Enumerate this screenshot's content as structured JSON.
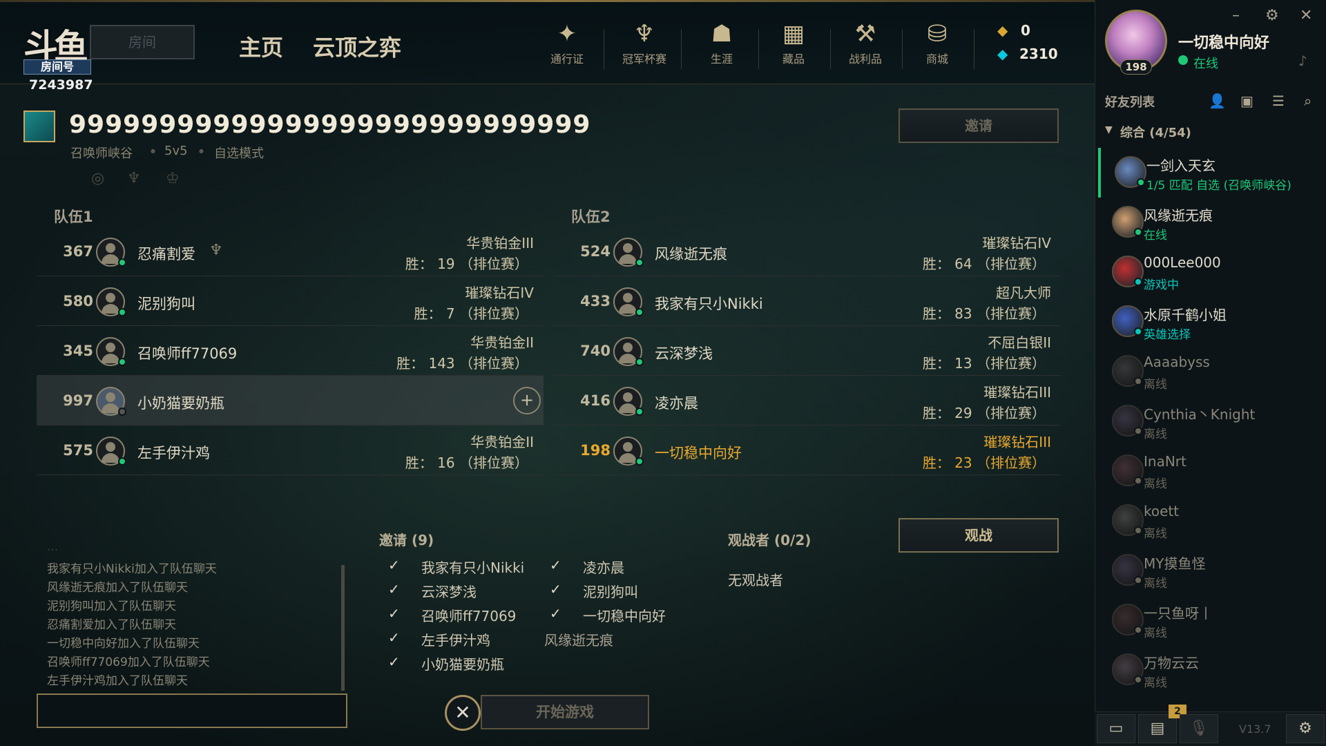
{
  "room": {
    "logo_text": "斗鱼",
    "tag": "房间号",
    "number": "7243987",
    "input_placeholder": "房间"
  },
  "nav": {
    "home": "主页",
    "tft": "云顶之弈"
  },
  "top_icons": [
    {
      "label": "通行证",
      "icon": "pass-icon"
    },
    {
      "label": "冠军杯赛",
      "icon": "trophy-icon"
    },
    {
      "label": "生涯",
      "icon": "profile-icon"
    },
    {
      "label": "藏品",
      "icon": "collection-icon"
    },
    {
      "label": "战利品",
      "icon": "loot-icon"
    },
    {
      "label": "商城",
      "icon": "store-icon"
    }
  ],
  "currency": {
    "rp": "0",
    "be": "2310"
  },
  "me": {
    "name": "一切稳中向好",
    "status": "在线",
    "level": "198"
  },
  "lobby": {
    "title": "99999999999999999999999999999",
    "map": "召唤师峡谷",
    "mode": "5v5",
    "queue": "自选模式",
    "invite_button": "邀请",
    "spectate_button": "观战"
  },
  "team1": {
    "label": "队伍1",
    "players": [
      {
        "num": "367",
        "name": "忍痛割爱",
        "rank": "华贵铂金III",
        "wins": "胜： 19 （排位赛）"
      },
      {
        "num": "580",
        "name": "泥别狗叫",
        "rank": "璀璨钻石IV",
        "wins": "胜： 7 （排位赛）"
      },
      {
        "num": "345",
        "name": "召唤师ff77069",
        "rank": "华贵铂金II",
        "wins": "胜： 143 （排位赛）"
      },
      {
        "num": "997",
        "name": "小奶猫要奶瓶",
        "rank": "",
        "wins": ""
      },
      {
        "num": "575",
        "name": "左手伊汁鸡",
        "rank": "华贵铂金II",
        "wins": "胜： 16 （排位赛）"
      }
    ]
  },
  "team2": {
    "label": "队伍2",
    "players": [
      {
        "num": "524",
        "name": "风缘逝无痕",
        "rank": "璀璨钻石IV",
        "wins": "胜： 64 （排位赛）"
      },
      {
        "num": "433",
        "name": "我家有只小Nikki",
        "rank": "超凡大师",
        "wins": "胜： 83 （排位赛）"
      },
      {
        "num": "740",
        "name": "云深梦浅",
        "rank": "不屈白银II",
        "wins": "胜： 13 （排位赛）"
      },
      {
        "num": "416",
        "name": "凌亦晨",
        "rank": "璀璨钻石III",
        "wins": "胜： 29 （排位赛）"
      },
      {
        "num": "198",
        "name": "一切稳中向好",
        "rank": "璀璨钻石III",
        "wins": "胜： 23 （排位赛）"
      }
    ]
  },
  "chat": {
    "lines": [
      "...",
      "我家有只小Nikki加入了队伍聊天",
      "风缘逝无痕加入了队伍聊天",
      "泥别狗叫加入了队伍聊天",
      "忍痛割爱加入了队伍聊天",
      "一切稳中向好加入了队伍聊天",
      "召唤师ff77069加入了队伍聊天",
      "左手伊汁鸡加入了队伍聊天"
    ]
  },
  "invites": {
    "header": "邀请 (9)",
    "col1": [
      {
        "name": "我家有只小Nikki",
        "check": "✓"
      },
      {
        "name": "云深梦浅",
        "check": "✓"
      },
      {
        "name": "召唤师ff77069",
        "check": "✓"
      },
      {
        "name": "左手伊汁鸡",
        "check": "✓"
      },
      {
        "name": "小奶猫要奶瓶",
        "check": "✓"
      }
    ],
    "col2": [
      {
        "name": "凌亦晨",
        "check": "✓"
      },
      {
        "name": "泥别狗叫",
        "check": "✓"
      },
      {
        "name": "一切稳中向好",
        "check": "✓"
      },
      {
        "name": "风缘逝无痕",
        "check": ""
      }
    ]
  },
  "spectators": {
    "header": "观战者 (0/2)",
    "empty": "无观战者"
  },
  "start": {
    "label": "开始游戏",
    "close": "✕"
  },
  "friends": {
    "title": "好友列表",
    "group": "综合 (4/54)",
    "list": [
      {
        "name": "一剑入天玄",
        "status": "1/5 匹配 自选 (召唤师峡谷)",
        "color": "#1ec878"
      },
      {
        "name": "风缘逝无痕",
        "status": "在线",
        "color": "#1ec878"
      },
      {
        "name": "000Lee000",
        "status": "游戏中",
        "color": "#0ac8b9"
      },
      {
        "name": "水原千鹤小姐",
        "status": "英雄选择",
        "color": "#0ac8b9"
      },
      {
        "name": "Aaaabyss",
        "status": "离线",
        "color": "#6a6658"
      },
      {
        "name": "Cynthia丶Knight",
        "status": "离线",
        "color": "#6a6658"
      },
      {
        "name": "InaNrt",
        "status": "离线",
        "color": "#6a6658"
      },
      {
        "name": "koett",
        "status": "离线",
        "color": "#6a6658"
      },
      {
        "name": "MY摸鱼怪",
        "status": "离线",
        "color": "#6a6658"
      },
      {
        "name": "一只鱼呀丨",
        "status": "离线",
        "color": "#6a6658"
      },
      {
        "name": "万物云云",
        "status": "离线",
        "color": "#6a6658"
      }
    ]
  },
  "bottom": {
    "badge": "2",
    "version": "V13.7"
  },
  "colors": {
    "accent": "#cdbe91",
    "online": "#1ec878",
    "ingame": "#0ac8b9",
    "self": "#e8a830"
  }
}
